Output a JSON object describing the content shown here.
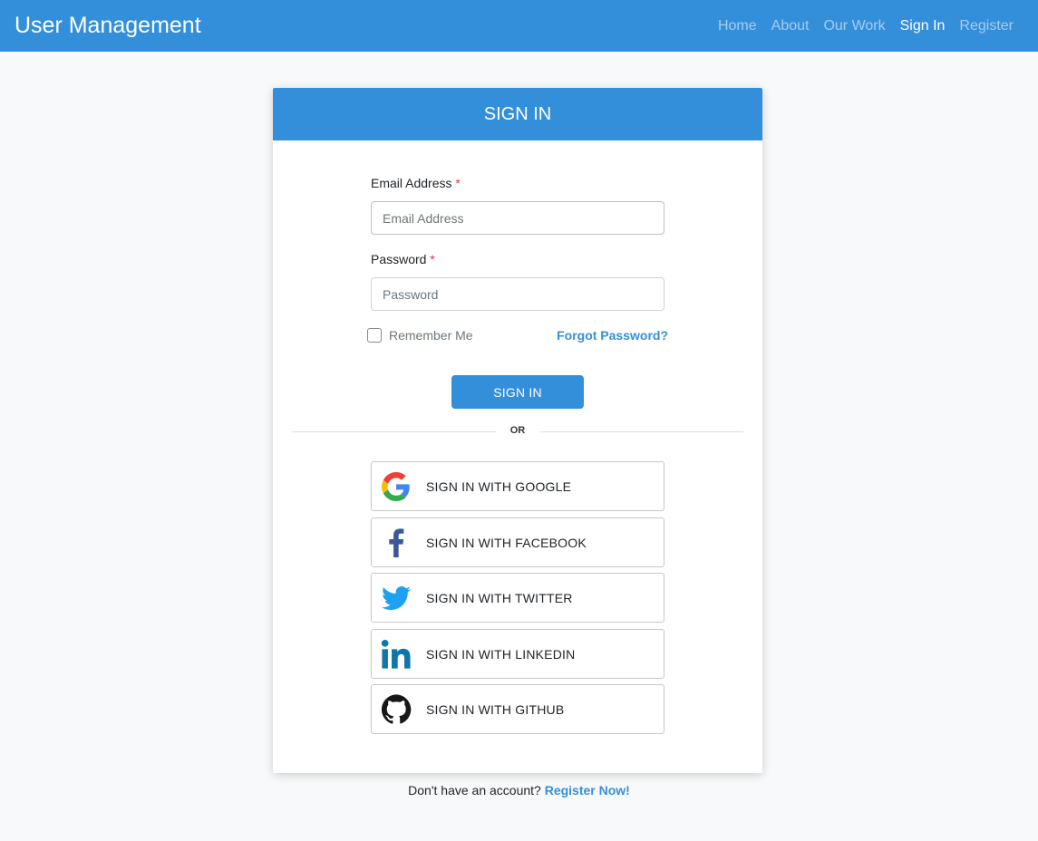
{
  "navbar": {
    "brand": "User Management",
    "links": [
      {
        "label": "Home",
        "active": false
      },
      {
        "label": "About",
        "active": false
      },
      {
        "label": "Our Work",
        "active": false
      },
      {
        "label": "Sign In",
        "active": true
      },
      {
        "label": "Register",
        "active": false
      }
    ]
  },
  "card": {
    "title": "SIGN IN",
    "email": {
      "label": "Email Address",
      "required_mark": "*",
      "placeholder": "Email Address",
      "value": ""
    },
    "password": {
      "label": "Password",
      "required_mark": "*",
      "placeholder": "Password",
      "value": ""
    },
    "remember_label": "Remember Me",
    "remember_checked": false,
    "forgot_label": "Forgot Password?",
    "submit_label": "SIGN IN",
    "divider_label": "OR",
    "social": [
      {
        "icon": "google-icon",
        "label": "SIGN IN WITH GOOGLE"
      },
      {
        "icon": "facebook-icon",
        "label": "SIGN IN WITH FACEBOOK"
      },
      {
        "icon": "twitter-icon",
        "label": "SIGN IN WITH TWITTER"
      },
      {
        "icon": "linkedin-icon",
        "label": "SIGN IN WITH LINKEDIN"
      },
      {
        "icon": "github-icon",
        "label": "SIGN IN WITH GITHUB"
      }
    ]
  },
  "footer": {
    "prompt": "Don't have an account?",
    "register_label": "Register Now!"
  },
  "colors": {
    "primary": "#348fdb",
    "required": "#dc3545",
    "background": "#f8f9fa",
    "facebook": "#3b5998",
    "twitter": "#1da1f2",
    "linkedin": "#0e76a8",
    "github": "#181717"
  }
}
